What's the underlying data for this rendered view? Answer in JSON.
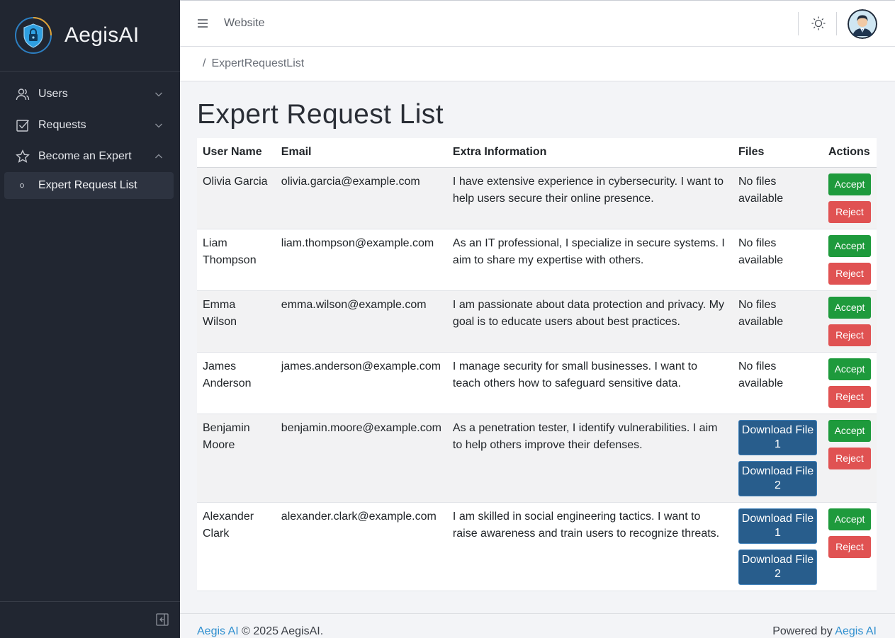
{
  "brand": {
    "name": "AegisAI"
  },
  "sidebar": {
    "items": [
      {
        "label": "Users",
        "icon": "users-icon",
        "expanded": false
      },
      {
        "label": "Requests",
        "icon": "check-square-icon",
        "expanded": false
      },
      {
        "label": "Become an Expert",
        "icon": "star-icon",
        "expanded": true
      }
    ],
    "sub_item": {
      "label": "Expert Request List",
      "active": true
    }
  },
  "header": {
    "link": "Website"
  },
  "breadcrumb": {
    "separator": "/",
    "current": "ExpertRequestList"
  },
  "page": {
    "title": "Expert Request List"
  },
  "table": {
    "columns": [
      "User Name",
      "Email",
      "Extra Information",
      "Files",
      "Actions"
    ],
    "accept_label": "Accept",
    "reject_label": "Reject",
    "no_files_label": "No files available",
    "rows": [
      {
        "name": "Olivia Garcia",
        "email": "olivia.garcia@example.com",
        "info": "I have extensive experience in cybersecurity. I want to help users secure their online presence.",
        "files": []
      },
      {
        "name": "Liam Thompson",
        "email": "liam.thompson@example.com",
        "info": "As an IT professional, I specialize in secure systems. I aim to share my expertise with others.",
        "files": []
      },
      {
        "name": "Emma Wilson",
        "email": "emma.wilson@example.com",
        "info": "I am passionate about data protection and privacy. My goal is to educate users about best practices.",
        "files": []
      },
      {
        "name": "James Anderson",
        "email": "james.anderson@example.com",
        "info": "I manage security for small businesses. I want to teach others how to safeguard sensitive data.",
        "files": []
      },
      {
        "name": "Benjamin Moore",
        "email": "benjamin.moore@example.com",
        "info": "As a penetration tester, I identify vulnerabilities. I aim to help others improve their defenses.",
        "files": [
          "Download File 1",
          "Download File 2"
        ]
      },
      {
        "name": "Alexander Clark",
        "email": "alexander.clark@example.com",
        "info": "I am skilled in social engineering tactics. I want to raise awareness and train users to recognize threats.",
        "files": [
          "Download File 1",
          "Download File 2"
        ]
      }
    ]
  },
  "footer": {
    "left_link": "Aegis AI",
    "left_text": "© 2025 AegisAI.",
    "right_text": "Powered by",
    "right_link": "Aegis AI"
  },
  "colors": {
    "sidebar_bg": "#212631",
    "accept": "#1e9a3c",
    "reject": "#e05252",
    "download": "#285d8c",
    "link": "#2f8fcf"
  }
}
